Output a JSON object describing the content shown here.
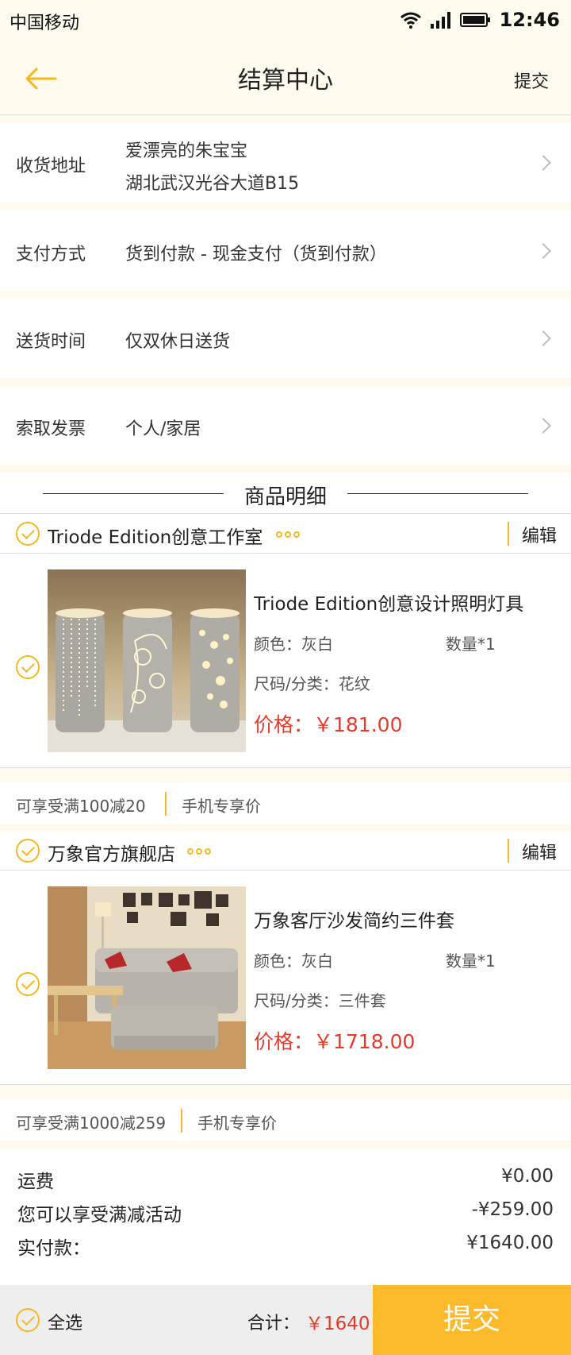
{
  "statusbar": {
    "carrier": "中国移动",
    "time": "12:46"
  },
  "nav": {
    "title": "结算中心",
    "submit": "提交"
  },
  "rows": {
    "address": {
      "label": "收货地址",
      "name": "爱漂亮的朱宝宝",
      "detail": "湖北武汉光谷大道B15"
    },
    "payment": {
      "label": "支付方式",
      "value": "货到付款 - 现金支付（货到付款）"
    },
    "delivery": {
      "label": "送货时间",
      "value": "仅双休日送货"
    },
    "invoice": {
      "label": "索取发票",
      "value": "个人/家居"
    }
  },
  "section_title": "商品明细",
  "shops": [
    {
      "name": "Triode Edition创意工作室",
      "edit": "编辑",
      "product": {
        "name": "Triode Edition创意设计照明灯具",
        "color": "颜色：灰白",
        "qty": "数量*1",
        "size": "尺码/分类：花纹",
        "price": "价格：￥181.00"
      },
      "promo": "可享受满100减20",
      "promo_tag": "手机专享价"
    },
    {
      "name": "万象官方旗舰店",
      "edit": "编辑",
      "product": {
        "name": "万象客厅沙发简约三件套",
        "color": "颜色：灰白",
        "qty": "数量*1",
        "size": "尺码/分类：三件套",
        "price": "价格：￥1718.00"
      },
      "promo": "可享受满1000减259",
      "promo_tag": "手机专享价"
    }
  ],
  "summary": {
    "shipping_label": "运费",
    "shipping_value": "¥0.00",
    "discount_label": "您可以享受满减活动",
    "discount_value": "-¥259.00",
    "paid_label": "实付款：",
    "paid_value": "¥1640.00"
  },
  "bottom": {
    "select_all": "全选",
    "total_label": "合计：",
    "total_value": "￥1640",
    "submit": "提交"
  },
  "colors": {
    "accent": "#f5b820",
    "price": "#e53a2a",
    "submit_bg": "#fbba2a"
  }
}
